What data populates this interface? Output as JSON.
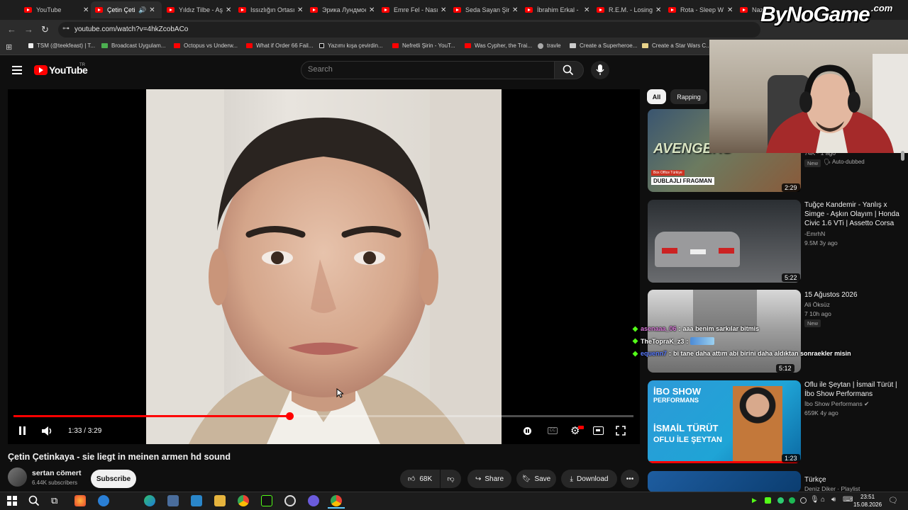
{
  "browser": {
    "tabs": [
      {
        "title": "YouTube",
        "active": false
      },
      {
        "title": "Çetin Çetinkaya",
        "active": true
      },
      {
        "title": "Yıldız Tilbe - Aşkın",
        "active": false
      },
      {
        "title": "Issızlığın Ortasında",
        "active": false
      },
      {
        "title": "Эрика Лундмоен",
        "active": false
      },
      {
        "title": "Emre Fel - Nasıl",
        "active": false
      },
      {
        "title": "Seda Sayan Şirin",
        "active": false
      },
      {
        "title": "İbrahim Erkal - ",
        "active": false
      },
      {
        "title": "R.E.M. - Losing",
        "active": false
      },
      {
        "title": "Rota - Sleep W",
        "active": false
      },
      {
        "title": "Nazan",
        "active": false
      }
    ],
    "url": "youtube.com/watch?v=4hkZcobACo",
    "bookmarks": [
      {
        "label": "TSM (@teekfeast) | T..."
      },
      {
        "label": "Broadcast Uygulam..."
      },
      {
        "label": "Octopus vs Underw..."
      },
      {
        "label": "What if Order 66 Fail..."
      },
      {
        "label": "Yazımı kışa çevirdin..."
      },
      {
        "label": "Nefretli Şirin - YouT..."
      },
      {
        "label": "Was Cypher, the Trai..."
      },
      {
        "label": "travle"
      },
      {
        "label": "Create a Superheroe..."
      },
      {
        "label": "Create a Star Wars C..."
      }
    ]
  },
  "watermark": "ByNoGame",
  "watermark_com": ".com",
  "youtube": {
    "logo": "YouTube",
    "region": "TR",
    "search_placeholder": "Search",
    "chips": [
      "All",
      "Rapping"
    ]
  },
  "player": {
    "time": "1:33 / 3:29",
    "progress": 0.445
  },
  "video": {
    "title": "Çetin Çetinkaya - sie liegt in meinen armen hd sound",
    "channel": "sertan cömert",
    "subscribers": "6.44K subscribers",
    "subscribe": "Subscribe",
    "likes": "68K",
    "share": "Share",
    "save": "Save",
    "download": "Download"
  },
  "sidebar": [
    {
      "thumb_text": "DUBLAJLI FRAGMAN",
      "thumb_tag": "Box Office Türkiye",
      "thumb_logo": "AVENGERS",
      "duration": "2:29",
      "meta": "74K · 1 ago",
      "badge1": "New",
      "badge2": "Auto-dubbed"
    },
    {
      "title": "Tuğçe Kandemir - Yanlış x Simge - Aşkın Olayım | Honda Civic 1.6 VTi | Assetto Corsa",
      "channel": "-EmrhN",
      "meta": "9.5M  3y ago",
      "duration": "5:22"
    },
    {
      "title": "15 Ağustos 2026",
      "channel": "Ali Öksüz",
      "meta": "7  10h ago",
      "badge": "New",
      "duration": "5:12"
    },
    {
      "title": "Oflu ile Şeytan | İsmail Türüt | İbo Show Performans",
      "channel": "İbo Show Performans",
      "meta": "659K  4y ago",
      "duration": "1:23",
      "thumb_text1": "İBO SHOW",
      "thumb_text2": "PERFORMANS",
      "thumb_text3": "İSMAİL TÜRÜT",
      "thumb_text4": "OFLU İLE ŞEYTAN"
    },
    {
      "title": "Türkçe",
      "channel": "Deniz Diker · Playlist"
    }
  ],
  "chat": [
    {
      "user": "asenaaa_06",
      "color": "#d97bd9",
      "message": "aaa benim sarkılar bitmis"
    },
    {
      "user": "TheTopraK_z3",
      "color": "#ffffff",
      "message": ""
    },
    {
      "user": "equenn7",
      "color": "#5a7bff",
      "message": "bi tane daha attım abi birini daha aldıktan sonraekler misin"
    }
  ],
  "taskbar": {
    "time": "23:51",
    "date": "15.08.2026"
  }
}
